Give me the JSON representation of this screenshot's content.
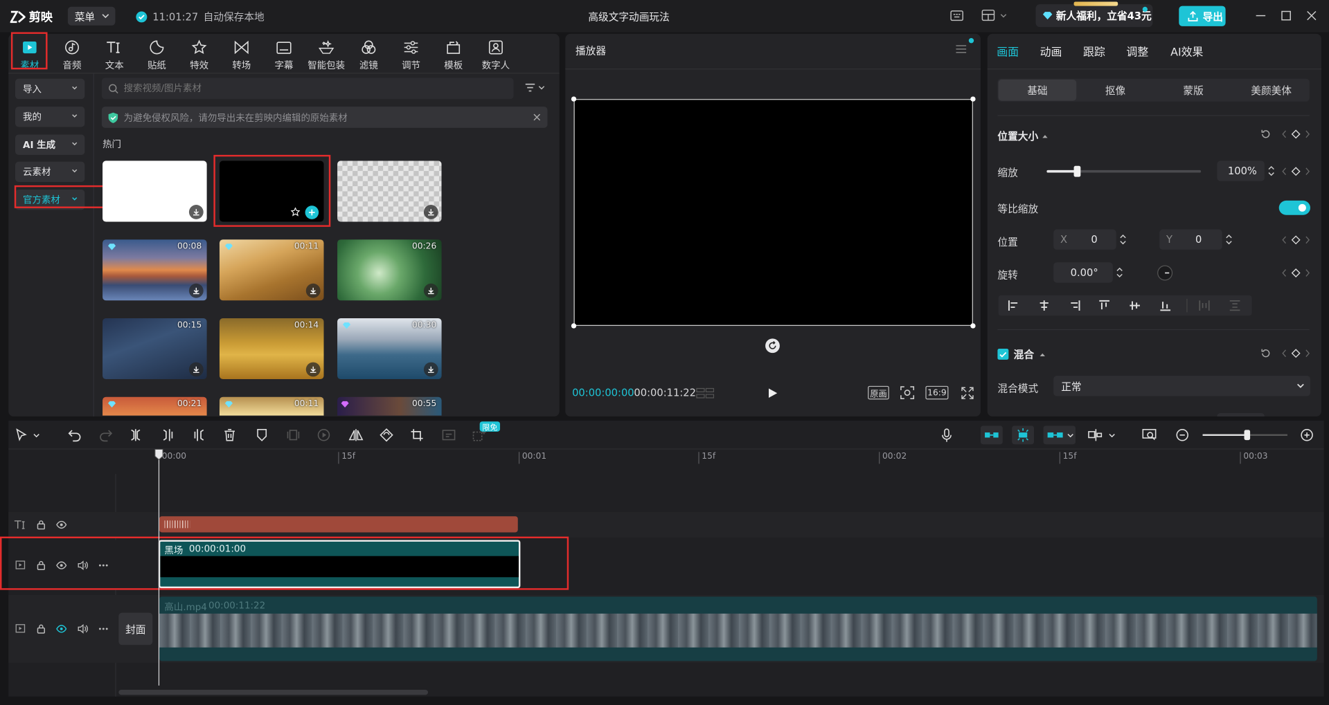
{
  "app": {
    "logo_text": "剪映",
    "menu_label": "菜单",
    "autosave_time": "11:01:27",
    "autosave_text": "自动保存本地",
    "project_title": "高级文字动画玩法",
    "promo_text": "新人福利，立省43元",
    "export_label": "导出"
  },
  "colors": {
    "accent": "#1ec4d6",
    "red_highlight": "#e42c2c",
    "text_clip": "#a0493a",
    "video_clip": "#0e5557"
  },
  "toolbar": [
    {
      "label": "素材",
      "icon": "media-icon"
    },
    {
      "label": "音频",
      "icon": "audio-icon"
    },
    {
      "label": "文本",
      "icon": "text-icon"
    },
    {
      "label": "贴纸",
      "icon": "sticker-icon"
    },
    {
      "label": "特效",
      "icon": "effects-icon"
    },
    {
      "label": "转场",
      "icon": "transition-icon"
    },
    {
      "label": "字幕",
      "icon": "subtitle-icon"
    },
    {
      "label": "智能包装",
      "icon": "smart-pack-icon"
    },
    {
      "label": "滤镜",
      "icon": "filter-icon"
    },
    {
      "label": "调节",
      "icon": "adjust-icon"
    },
    {
      "label": "模板",
      "icon": "template-icon"
    },
    {
      "label": "数字人",
      "icon": "digital-human-icon"
    }
  ],
  "sidebar": [
    {
      "label": "导入"
    },
    {
      "label": "我的"
    },
    {
      "label": "AI 生成"
    },
    {
      "label": "云素材"
    },
    {
      "label": "官方素材"
    }
  ],
  "search": {
    "placeholder": "搜索视频/图片素材"
  },
  "notice": {
    "text": "为避免侵权风险，请勿导出未在剪映内编辑的原始素材"
  },
  "section_title": "热门",
  "thumbnails": [
    {
      "kind": "white",
      "duration": ""
    },
    {
      "kind": "black",
      "duration": ""
    },
    {
      "kind": "transparent",
      "duration": ""
    },
    {
      "kind": "sunset",
      "duration": "00:08"
    },
    {
      "kind": "wheat",
      "duration": "00:11"
    },
    {
      "kind": "forest",
      "duration": "00:26"
    },
    {
      "kind": "rain",
      "duration": "00:15"
    },
    {
      "kind": "autumn",
      "duration": "00:14"
    },
    {
      "kind": "sea",
      "duration": "00:30"
    },
    {
      "kind": "dusk",
      "duration": "00:21"
    },
    {
      "kind": "sun",
      "duration": "00:11"
    },
    {
      "kind": "earth",
      "duration": "00:55"
    }
  ],
  "player": {
    "title": "播放器",
    "current_time": "00:00:00:00",
    "total_time": "00:00:11:22",
    "original_label": "原画",
    "ratio_label": "16:9"
  },
  "inspector": {
    "tabs": [
      "画面",
      "动画",
      "跟踪",
      "调整",
      "AI效果"
    ],
    "subtabs": [
      "基础",
      "抠像",
      "蒙版",
      "美颜美体"
    ],
    "section_position": "位置大小",
    "scale_label": "缩放",
    "scale_value": "100%",
    "scale_fraction": 0.2,
    "uniform_label": "等比缩放",
    "position_label": "位置",
    "x_label": "X",
    "x_value": "0",
    "y_label": "Y",
    "y_value": "0",
    "rotate_label": "旋转",
    "rotate_value": "0.00°",
    "blend_section": "混合",
    "blend_mode_label": "混合模式",
    "blend_mode_value": "正常"
  },
  "timeline": {
    "free_badge": "限免",
    "ruler": [
      "00:00",
      "15f",
      "00:01",
      "15f",
      "00:02",
      "15f",
      "00:03"
    ],
    "clip_black_name": "黑场",
    "clip_black_duration": "00:00:01:00",
    "clip_main_name": "高山.mp4",
    "clip_main_duration": "00:00:11:22",
    "cover_label": "封面"
  }
}
